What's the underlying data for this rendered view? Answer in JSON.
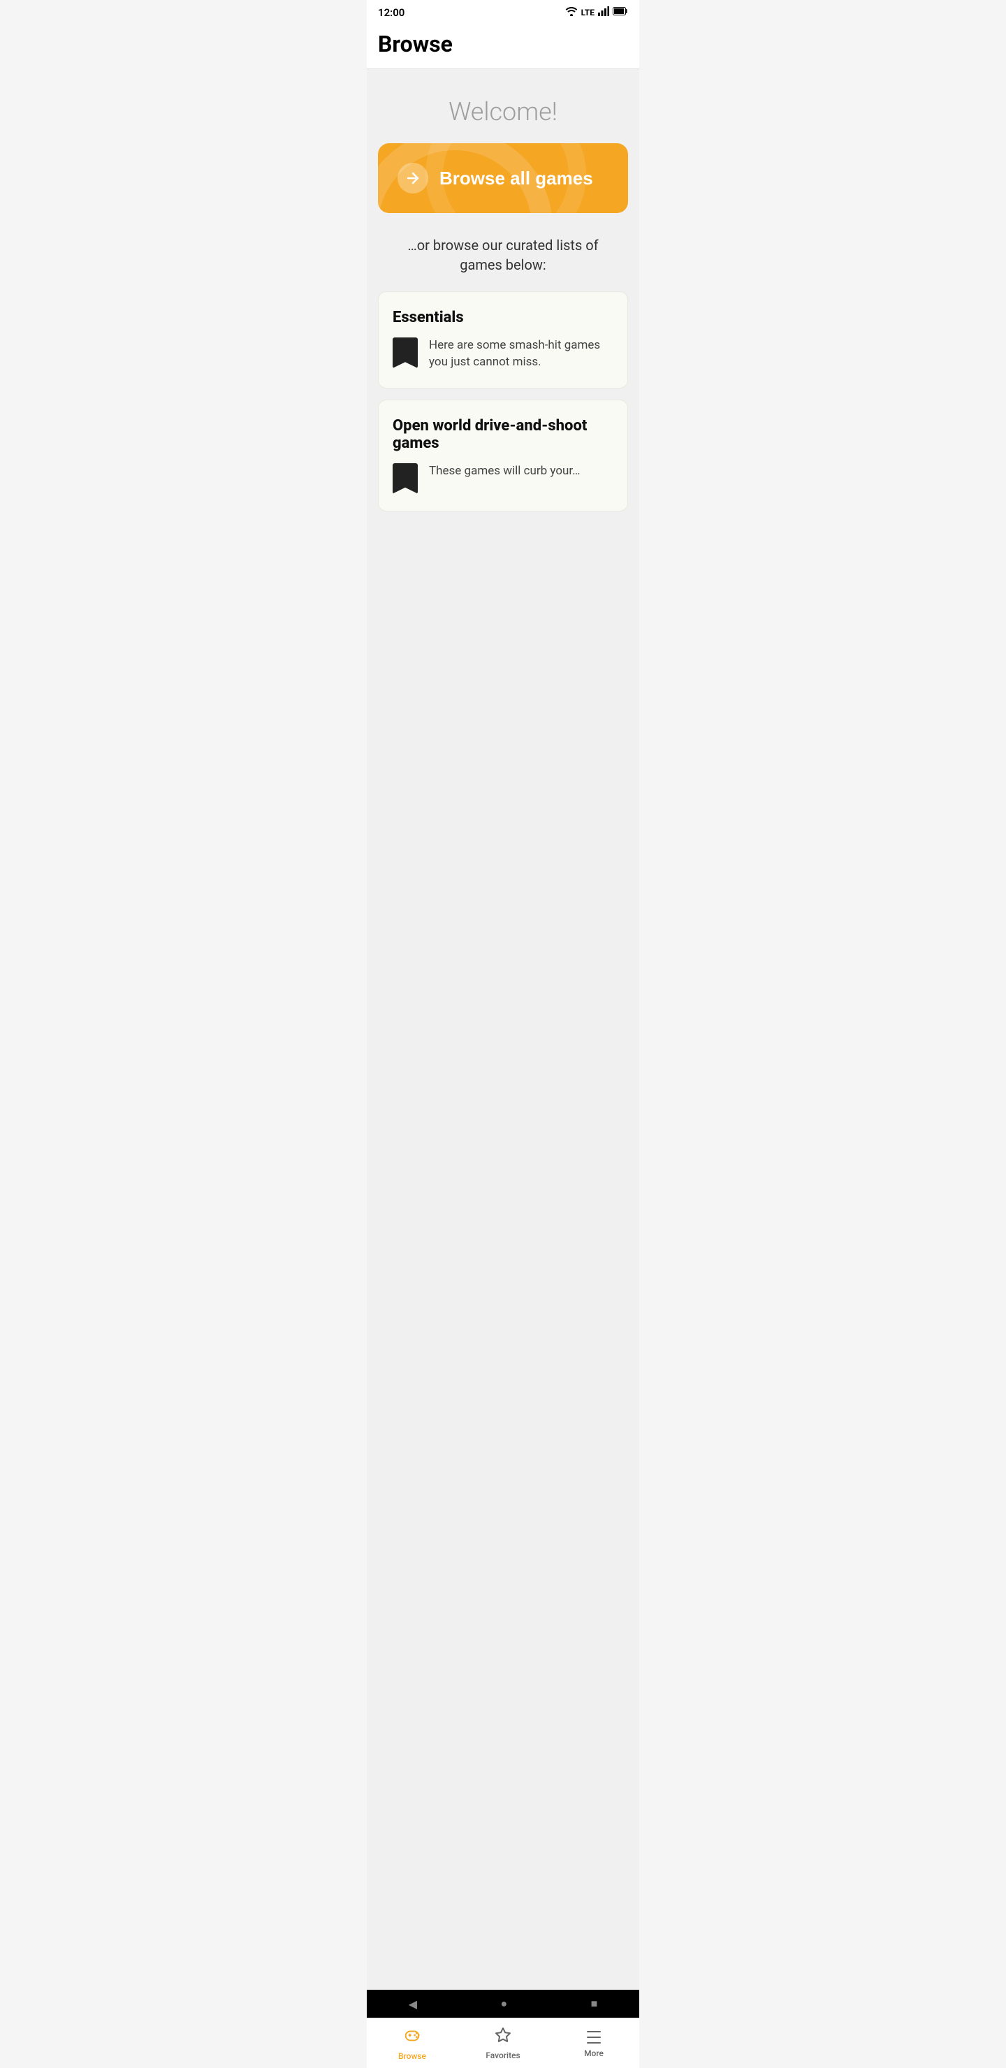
{
  "statusBar": {
    "time": "12:00",
    "signal": "LTE"
  },
  "header": {
    "title": "Browse"
  },
  "main": {
    "welcomeText": "Welcome!",
    "browseAllButton": {
      "label": "Browse all games",
      "arrowIcon": "arrow-right-icon"
    },
    "subtextLine1": "…or browse our curated lists of",
    "subtextLine2": "games below:",
    "listCards": [
      {
        "title": "Essentials",
        "description": "Here are some smash-hit games you just cannot miss.",
        "bookmarkIcon": "bookmark-icon"
      },
      {
        "title": "Open world drive-and-shoot games",
        "description": "These games will curb your…",
        "bookmarkIcon": "bookmark-icon"
      }
    ]
  },
  "bottomNav": {
    "items": [
      {
        "id": "browse",
        "label": "Browse",
        "active": true,
        "icon": "gamepad-icon"
      },
      {
        "id": "favorites",
        "label": "Favorites",
        "active": false,
        "icon": "star-icon"
      },
      {
        "id": "more",
        "label": "More",
        "active": false,
        "icon": "more-icon"
      }
    ]
  },
  "androidNav": {
    "back": "◀",
    "home": "●",
    "recents": "■"
  },
  "colors": {
    "orange": "#f5a623",
    "activeNav": "#f5a623",
    "inactiveNav": "#666666"
  }
}
